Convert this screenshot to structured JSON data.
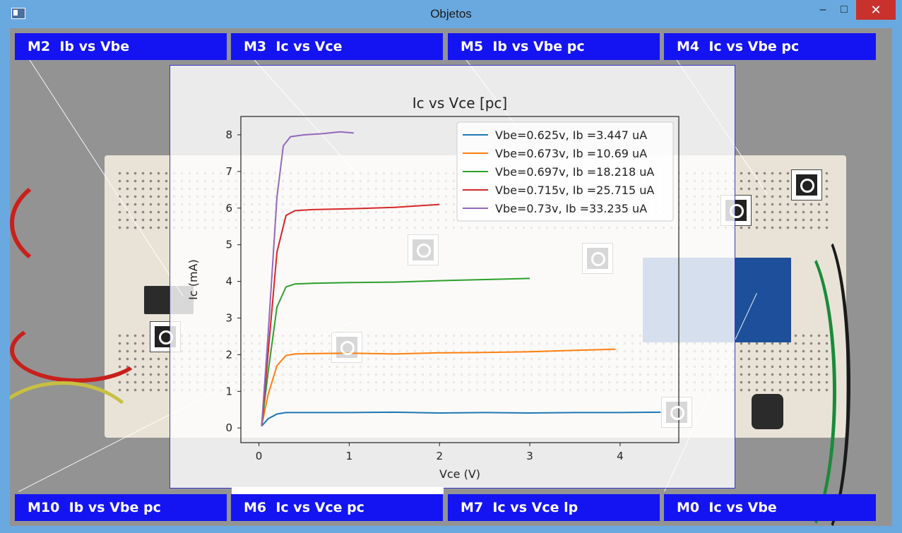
{
  "window": {
    "title": "Objetos",
    "min_icon": "minimize-icon",
    "max_icon": "maximize-icon",
    "close_icon": "close-icon",
    "app_icon": "window-app-icon"
  },
  "buttons_top": [
    {
      "id": "M2",
      "label": "M2  Ib vs Vbe"
    },
    {
      "id": "M3",
      "label": "M3  Ic vs Vce"
    },
    {
      "id": "M5",
      "label": "M5  Ib vs Vbe pc"
    },
    {
      "id": "M4",
      "label": "M4  Ic vs Vbe pc"
    }
  ],
  "buttons_bottom": [
    {
      "id": "M10",
      "label": "M10  Ib vs Vbe pc"
    },
    {
      "id": "M6",
      "label": "M6  Ic vs Vce pc"
    },
    {
      "id": "M7",
      "label": "M7  Ic vs Vce lp"
    },
    {
      "id": "M0",
      "label": "M0  Ic vs Vbe"
    }
  ],
  "colors": {
    "button_bg": "#1414f2",
    "series": [
      "#1f77b4",
      "#ff7f0e",
      "#2ca02c",
      "#d62728",
      "#9467bd"
    ]
  },
  "chart_data": {
    "type": "line",
    "title": "Ic vs Vce [pc]",
    "xlabel": "Vce (V)",
    "ylabel": "Ic (mA)",
    "xlim": [
      -0.2,
      4.65
    ],
    "ylim": [
      -0.4,
      8.5
    ],
    "xticks": [
      0,
      1,
      2,
      3,
      4
    ],
    "yticks": [
      0,
      1,
      2,
      3,
      4,
      5,
      6,
      7,
      8
    ],
    "legend_position": "top-right",
    "series": [
      {
        "name": "Vbe=0.625v, Ib =3.447 uA",
        "x": [
          0.03,
          0.1,
          0.2,
          0.3,
          0.5,
          1.0,
          1.5,
          2.0,
          2.5,
          3.0,
          3.5,
          4.0,
          4.45
        ],
        "y": [
          0.05,
          0.25,
          0.38,
          0.42,
          0.42,
          0.42,
          0.43,
          0.41,
          0.42,
          0.41,
          0.42,
          0.42,
          0.43
        ]
      },
      {
        "name": "Vbe=0.673v, Ib =10.69 uA",
        "x": [
          0.03,
          0.1,
          0.2,
          0.3,
          0.4,
          0.6,
          1.0,
          1.5,
          2.0,
          2.5,
          3.0,
          3.5,
          3.95
        ],
        "y": [
          0.05,
          0.9,
          1.7,
          1.98,
          2.02,
          2.03,
          2.04,
          2.02,
          2.05,
          2.06,
          2.08,
          2.12,
          2.15
        ]
      },
      {
        "name": "Vbe=0.697v, Ib =18.218 uA",
        "x": [
          0.03,
          0.1,
          0.2,
          0.3,
          0.4,
          0.6,
          1.0,
          1.5,
          2.0,
          2.5,
          3.0
        ],
        "y": [
          0.05,
          1.5,
          3.3,
          3.85,
          3.93,
          3.95,
          3.97,
          3.98,
          4.02,
          4.05,
          4.08
        ]
      },
      {
        "name": "Vbe=0.715v, Ib =25.715 uA",
        "x": [
          0.03,
          0.1,
          0.2,
          0.3,
          0.4,
          0.6,
          1.0,
          1.5,
          2.0
        ],
        "y": [
          0.05,
          2.0,
          4.8,
          5.8,
          5.93,
          5.96,
          5.98,
          6.02,
          6.1
        ]
      },
      {
        "name": "Vbe=0.73v, Ib =33.235 uA",
        "x": [
          0.03,
          0.1,
          0.2,
          0.27,
          0.35,
          0.5,
          0.7,
          0.9,
          1.05
        ],
        "y": [
          0.05,
          2.5,
          6.3,
          7.7,
          7.95,
          8.0,
          8.03,
          8.08,
          8.05
        ]
      }
    ]
  }
}
